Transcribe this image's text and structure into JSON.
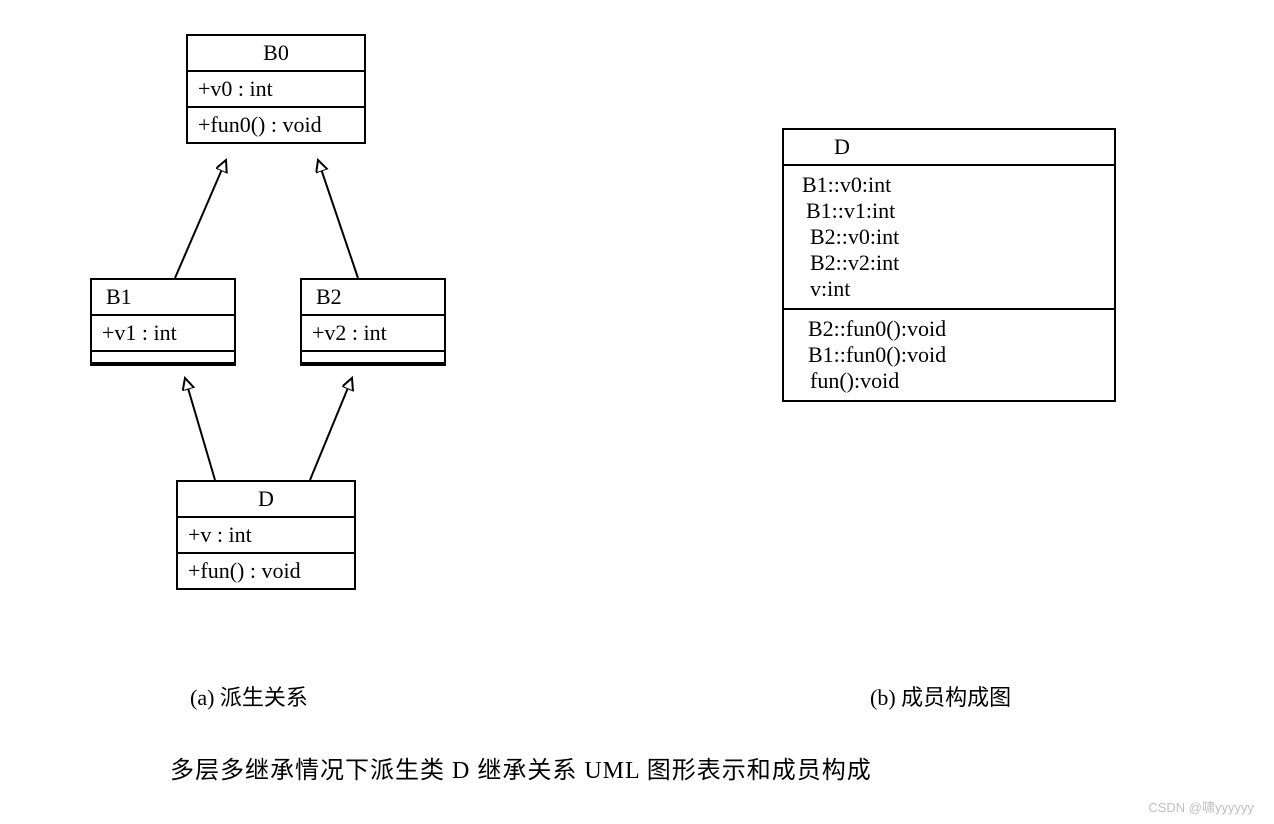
{
  "diagram": {
    "left": {
      "B0": {
        "name": "B0",
        "attr": "+v0 : int",
        "op": "+fun0() : void"
      },
      "B1": {
        "name": "B1",
        "attr": "+v1 : int"
      },
      "B2": {
        "name": "B2",
        "attr": "+v2 : int"
      },
      "D": {
        "name": "D",
        "attr": "+v : int",
        "op": "+fun() : void"
      },
      "caption": "(a) 派生关系"
    },
    "right": {
      "D": {
        "name": "D",
        "attrs": [
          "B1::v0:int",
          "B1::v1:int",
          "B2::v0:int",
          "B2::v2:int",
          "v:int"
        ],
        "ops": [
          "B2::fun0():void",
          "B1::fun0():void",
          "fun():void"
        ]
      },
      "caption": "(b) 成员构成图"
    },
    "mainCaption": "多层多继承情况下派生类 D 继承关系 UML 图形表示和成员构成",
    "watermark": "CSDN @啸yyyyyy"
  }
}
